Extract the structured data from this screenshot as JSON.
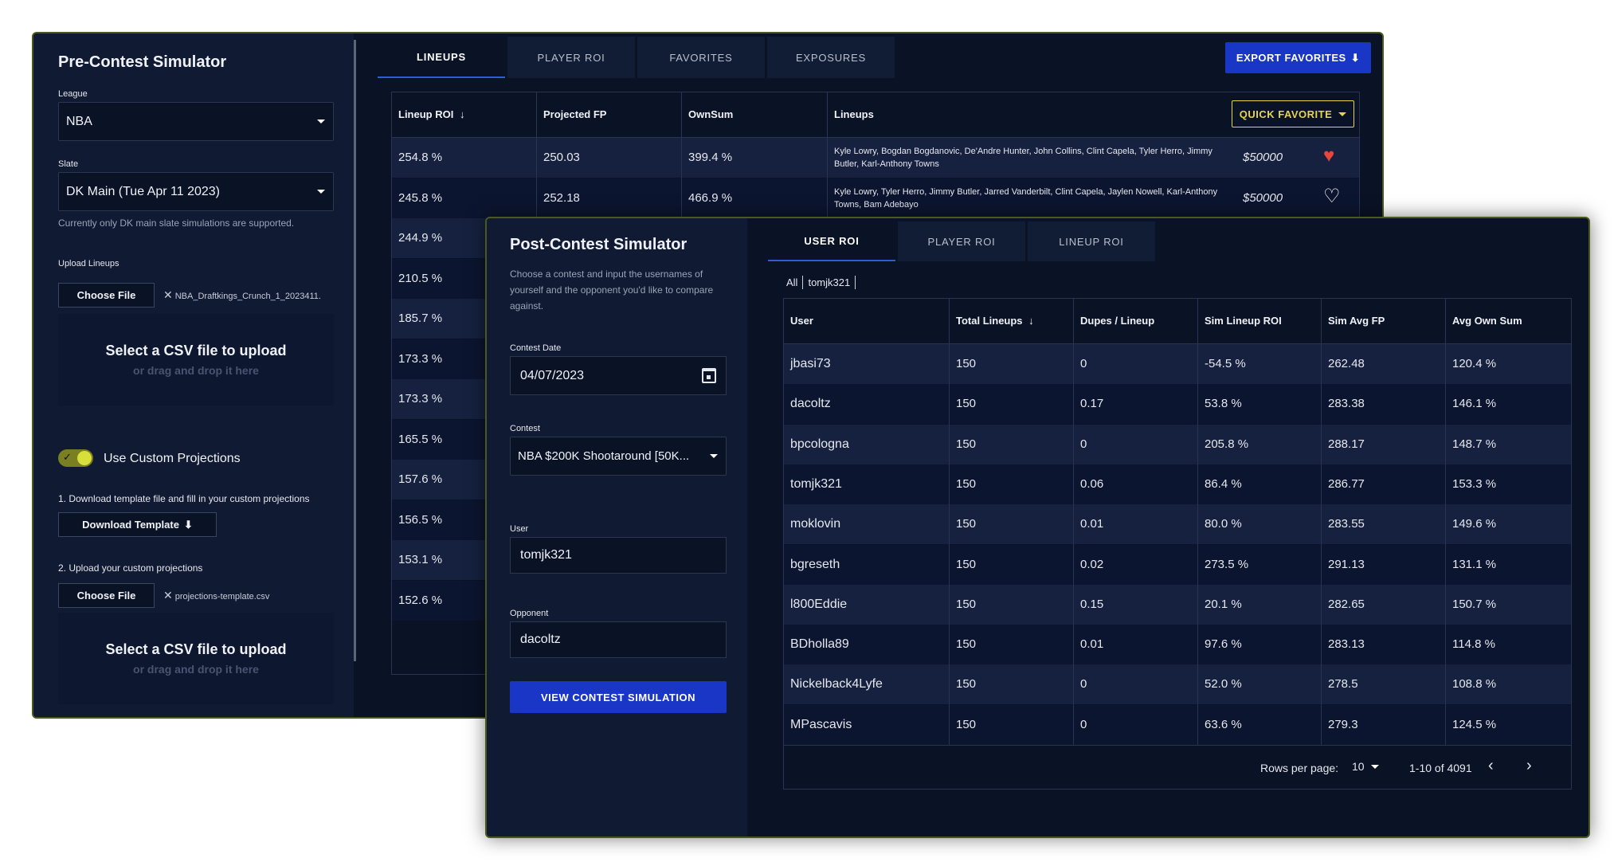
{
  "pre": {
    "title": "Pre-Contest Simulator",
    "league_label": "League",
    "league_value": "NBA",
    "slate_label": "Slate",
    "slate_value": "DK Main (Tue Apr 11 2023)",
    "slate_hint": "Currently only DK main slate simulations are supported.",
    "upload_label": "Upload Lineups",
    "choose_file": "Choose File",
    "lineups_filename": "NBA_Draftkings_Crunch_1_2023411.",
    "drop_title": "Select a CSV file to upload",
    "drop_sub": "or drag and drop it here",
    "toggle_label": "Use Custom Projections",
    "toggle_on": true,
    "step1": "1. Download template file and fill in your custom projections",
    "download_template": "Download Template",
    "step2": "2. Upload your custom projections",
    "proj_filename": "projections-template.csv",
    "tabs": [
      "LINEUPS",
      "PLAYER ROI",
      "FAVORITES",
      "EXPOSURES"
    ],
    "export_label": "EXPORT FAVORITES",
    "quick_fav_label": "QUICK FAVORITE",
    "columns": [
      "Lineup ROI",
      "Projected FP",
      "OwnSum",
      "Lineups"
    ],
    "rows": [
      {
        "roi": "254.8 %",
        "fp": "250.03",
        "own": "399.4 %",
        "lineup": "Kyle Lowry, Bogdan Bogdanovic, De'Andre Hunter, John Collins, Clint Capela, Tyler Herro, Jimmy Butler, Karl-Anthony Towns",
        "price": "$50000",
        "fav": true
      },
      {
        "roi": "245.8 %",
        "fp": "252.18",
        "own": "466.9 %",
        "lineup": "Kyle Lowry, Tyler Herro, Jimmy Butler, Jarred Vanderbilt, Clint Capela, Jaylen Nowell, Karl-Anthony Towns, Bam Adebayo",
        "price": "$50000",
        "fav": false
      },
      {
        "roi": "244.9 %"
      },
      {
        "roi": "210.5 %"
      },
      {
        "roi": "185.7 %"
      },
      {
        "roi": "173.3 %"
      },
      {
        "roi": "173.3 %"
      },
      {
        "roi": "165.5 %"
      },
      {
        "roi": "157.6 %"
      },
      {
        "roi": "156.5 %"
      },
      {
        "roi": "153.1 %"
      },
      {
        "roi": "152.6 %"
      }
    ]
  },
  "post": {
    "title": "Post-Contest Simulator",
    "desc": "Choose a contest and input the usernames of yourself and the opponent you'd like to compare against.",
    "date_label": "Contest Date",
    "date_value": "04/07/2023",
    "contest_label": "Contest",
    "contest_value": "NBA $200K Shootaround [50K...",
    "user_label": "User",
    "user_value": "tomjk321",
    "opp_label": "Opponent",
    "opp_value": "dacoltz",
    "view_btn": "VIEW CONTEST SIMULATION",
    "tabs": [
      "USER ROI",
      "PLAYER ROI",
      "LINEUP ROI"
    ],
    "filter_all": "All",
    "filter_user": "tomjk321",
    "columns": [
      "User",
      "Total Lineups",
      "Dupes / Lineup",
      "Sim Lineup ROI",
      "Sim Avg FP",
      "Avg Own Sum"
    ],
    "rows": [
      [
        "jbasi73",
        "150",
        "0",
        "-54.5 %",
        "262.48",
        "120.4 %"
      ],
      [
        "dacoltz",
        "150",
        "0.17",
        "53.8 %",
        "283.38",
        "146.1 %"
      ],
      [
        "bpcologna",
        "150",
        "0",
        "205.8 %",
        "288.17",
        "148.7 %"
      ],
      [
        "tomjk321",
        "150",
        "0.06",
        "86.4 %",
        "286.77",
        "153.3 %"
      ],
      [
        "moklovin",
        "150",
        "0.01",
        "80.0 %",
        "283.55",
        "149.6 %"
      ],
      [
        "bgreseth",
        "150",
        "0.02",
        "273.5 %",
        "291.13",
        "131.1 %"
      ],
      [
        "l800Eddie",
        "150",
        "0.15",
        "20.1 %",
        "282.65",
        "150.7 %"
      ],
      [
        "BDholla89",
        "150",
        "0.01",
        "97.6 %",
        "283.13",
        "114.8 %"
      ],
      [
        "Nickelback4Lyfe",
        "150",
        "0",
        "52.0 %",
        "278.5",
        "108.8 %"
      ],
      [
        "MPascavis",
        "150",
        "0",
        "63.6 %",
        "279.3",
        "124.5 %"
      ]
    ],
    "rows_per_page_label": "Rows per page:",
    "rows_per_page": "10",
    "range": "1-10 of 4091"
  },
  "colors": {
    "accent": "#1a36c7",
    "favorite": "#e8453c",
    "quick_favorite": "#e6d44a",
    "toggle": "#c9cf3a"
  }
}
